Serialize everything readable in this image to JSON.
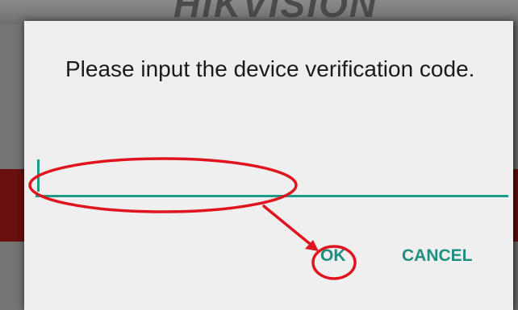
{
  "background": {
    "logo_text": "HIKVISION"
  },
  "dialog": {
    "title": "Please input the device verification code.",
    "input": {
      "value": "",
      "placeholder": ""
    },
    "buttons": {
      "ok_label": "OK",
      "cancel_label": "CANCEL"
    }
  },
  "colors": {
    "accent": "#1d9a8a",
    "annotation": "#e0141e",
    "dialog_bg": "#efefef"
  }
}
